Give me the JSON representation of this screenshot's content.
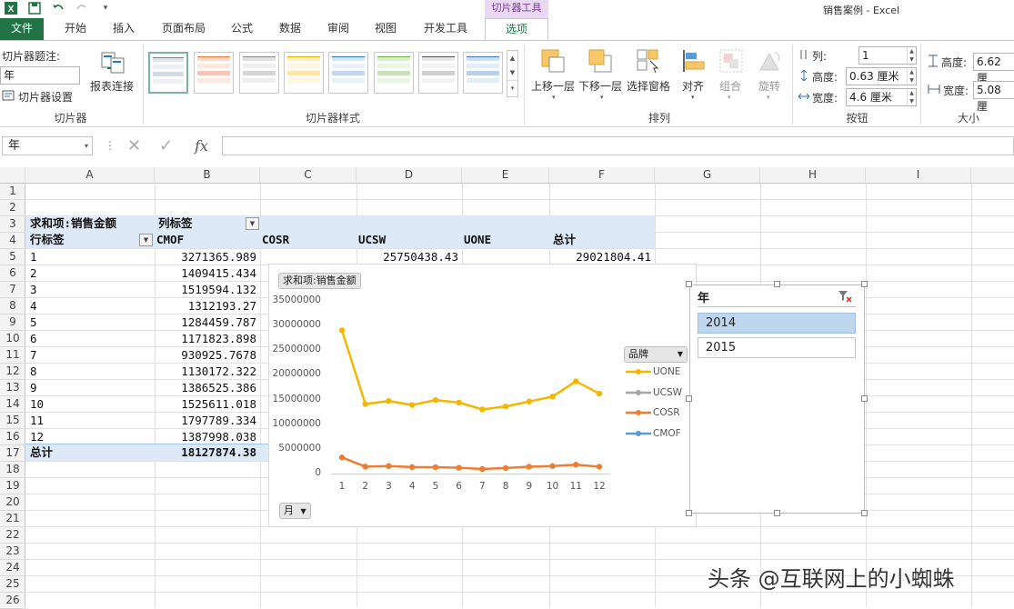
{
  "window": {
    "title": "销售案例 - Excel",
    "context_group": "切片器工具"
  },
  "tabs": [
    "文件",
    "开始",
    "插入",
    "页面布局",
    "公式",
    "数据",
    "审阅",
    "视图",
    "开发工具",
    "选项"
  ],
  "ribbon": {
    "slicer_group": {
      "caption_label": "切片器题注:",
      "caption_value": "年",
      "settings_label": "切片器设置",
      "report_conn_label": "报表连接",
      "group_label": "切片器"
    },
    "styles_group": {
      "group_label": "切片器样式"
    },
    "arrange_group": {
      "bring_forward": "上移一层",
      "send_backward": "下移一层",
      "selection_pane": "选择窗格",
      "align": "对齐",
      "group": "组合",
      "rotate": "旋转",
      "group_label": "排列"
    },
    "buttons_group": {
      "columns_label": "列:",
      "columns_value": "1",
      "height_label": "高度:",
      "height_value": "0.63 厘米",
      "width_label": "宽度:",
      "width_value": "4.6 厘米",
      "group_label": "按钮"
    },
    "size_group": {
      "height_label": "高度:",
      "height_value": "6.62 厘",
      "width_label": "宽度:",
      "width_value": "5.08 厘",
      "group_label": "大小"
    }
  },
  "formula_bar": {
    "name_box": "年",
    "fx": "fx",
    "formula": ""
  },
  "columns": [
    "A",
    "B",
    "C",
    "D",
    "E",
    "F",
    "G",
    "H",
    "I"
  ],
  "rows": [
    "1",
    "2",
    "3",
    "4",
    "5",
    "6",
    "7",
    "8",
    "9",
    "10",
    "11",
    "12",
    "13",
    "14",
    "15",
    "16",
    "17",
    "18",
    "19",
    "20",
    "21",
    "22",
    "23",
    "24",
    "25",
    "26"
  ],
  "pivot": {
    "corner_label": "求和项:销售金额",
    "col_label": "列标签",
    "row_label": "行标签",
    "col_headers": [
      "CMOF",
      "COSR",
      "UCSW",
      "UONE",
      "总计"
    ],
    "row_labels": [
      "1",
      "2",
      "3",
      "4",
      "5",
      "6",
      "7",
      "8",
      "9",
      "10",
      "11",
      "12"
    ],
    "cmof_values": [
      "3271365.989",
      "1409415.434",
      "1519594.132",
      "1312193.27",
      "1284459.787",
      "1171823.898",
      "930925.7678",
      "1130172.322",
      "1386525.386",
      "1525611.018",
      "1797789.334",
      "1387998.038"
    ],
    "row5_ucsw": "25750438.43",
    "row5_total": "29021804.41",
    "total_label": "总计",
    "total_value": "18127874.38"
  },
  "chart": {
    "value_button": "求和项:销售金额",
    "axis_button": "月",
    "legend_button": "品牌"
  },
  "chart_data": {
    "type": "line",
    "categories": [
      "1",
      "2",
      "3",
      "4",
      "5",
      "6",
      "7",
      "8",
      "9",
      "10",
      "11",
      "12"
    ],
    "yticks": [
      "35000000",
      "30000000",
      "25000000",
      "20000000",
      "15000000",
      "10000000",
      "5000000",
      "0"
    ],
    "ylim": [
      0,
      35000000
    ],
    "series": [
      {
        "name": "UONE",
        "color": "#f2b800",
        "values": [
          29021804,
          14100000,
          14700000,
          13900000,
          14900000,
          14400000,
          13000000,
          13600000,
          14600000,
          15600000,
          18700000,
          16200000
        ]
      },
      {
        "name": "UCSW",
        "color": "#a5a5a5",
        "values": []
      },
      {
        "name": "COSR",
        "color": "#ed7d31",
        "values": [
          3271366,
          1409415,
          1519594,
          1312193,
          1284460,
          1171824,
          930926,
          1130172,
          1386525,
          1525611,
          1797789,
          1387998
        ]
      },
      {
        "name": "CMOF",
        "color": "#5b9bd5",
        "values": []
      }
    ],
    "grid": false,
    "legend": "right"
  },
  "slicer": {
    "title": "年",
    "items": [
      "2014",
      "2015"
    ],
    "selected": "2014"
  },
  "watermark": "头条 @互联网上的小蜘蛛"
}
